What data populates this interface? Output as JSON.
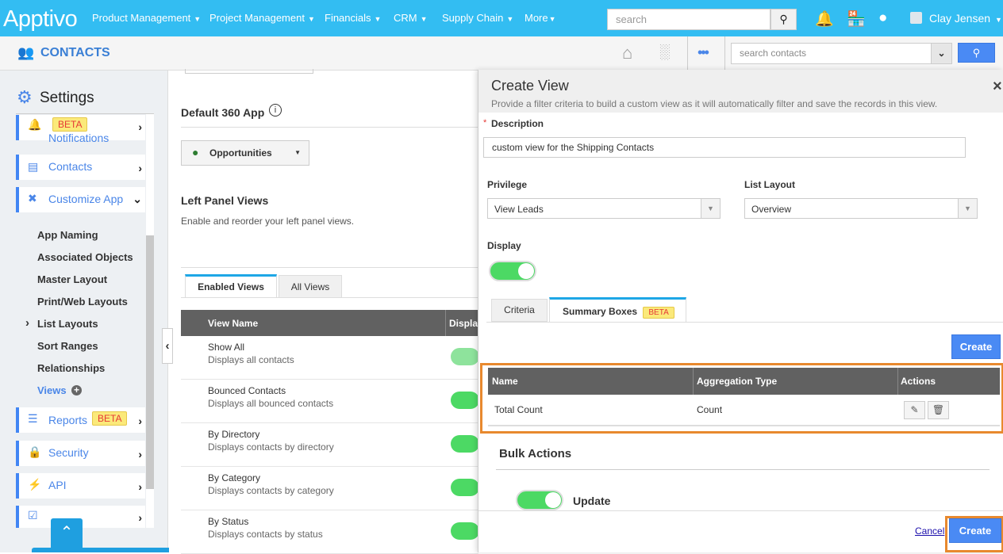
{
  "topbar": {
    "logo": "Apptivo",
    "nav": [
      "Product Management",
      "Project Management",
      "Financials",
      "CRM",
      "Supply Chain",
      "More"
    ],
    "search_placeholder": "search",
    "user": "Clay Jensen"
  },
  "subbar": {
    "title": "CONTACTS",
    "search_placeholder": "search contacts"
  },
  "sidebar": {
    "title": "Settings",
    "items": [
      {
        "label": "Notifications",
        "badge": "BETA"
      },
      {
        "label": "Contacts"
      },
      {
        "label": "Customize App"
      },
      {
        "label": "Reports",
        "badge": "BETA"
      },
      {
        "label": "Security"
      },
      {
        "label": "API"
      },
      {
        "label": ""
      }
    ],
    "subitems": [
      "App Naming",
      "Associated Objects",
      "Master Layout",
      "Print/Web Layouts",
      "List Layouts",
      "Sort Ranges",
      "Relationships",
      "Views"
    ]
  },
  "main": {
    "default_app_label": "Default 360 App",
    "default_app_value": "Opportunities",
    "left_panel_title": "Left Panel Views",
    "left_panel_desc": "Enable and reorder your left panel views.",
    "tabs": [
      "Enabled Views",
      "All Views"
    ],
    "columns": [
      "View Name",
      "Display"
    ],
    "rows": [
      {
        "name": "Show All",
        "desc": "Displays all contacts"
      },
      {
        "name": "Bounced Contacts",
        "desc": "Displays all bounced contacts"
      },
      {
        "name": "By Directory",
        "desc": "Displays contacts by directory"
      },
      {
        "name": "By Category",
        "desc": "Displays contacts by category"
      },
      {
        "name": "By Status",
        "desc": "Displays contacts by status"
      }
    ]
  },
  "modal": {
    "title": "Create View",
    "subtitle": "Provide a filter criteria to build a custom view as it will automatically filter and save the records in this view.",
    "description_label": "Description",
    "required_mark": "*",
    "description_value": "custom view for the Shipping Contacts",
    "privilege_label": "Privilege",
    "privilege_value": "View Leads",
    "list_layout_label": "List Layout",
    "list_layout_value": "Overview",
    "display_label": "Display",
    "display_on": true,
    "tabs": [
      "Criteria",
      "Summary Boxes"
    ],
    "tab_badge": "BETA",
    "create_label": "Create",
    "columns": [
      "Name",
      "Aggregation Type",
      "Actions"
    ],
    "rows": [
      {
        "name": "Total Count",
        "aggregation": "Count"
      }
    ],
    "bulk_actions": "Bulk Actions",
    "update_label": "Update",
    "update_on": true,
    "cancel": "Cancel",
    "create_footer": "Create"
  },
  "colors": {
    "topbar": "#33bdf2",
    "accent": "#4a8af4",
    "highlight": "#e8892e",
    "toggle": "#4cd964"
  }
}
